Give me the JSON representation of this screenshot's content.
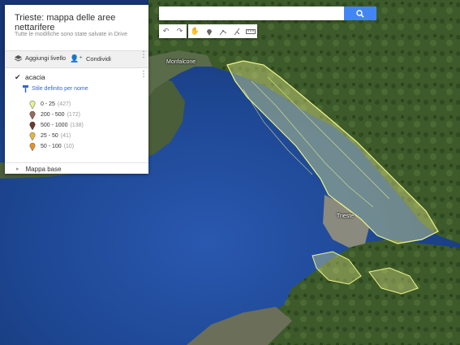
{
  "panel": {
    "title": "Trieste: mappa delle aree nettarifere",
    "subtitle": "Tutte le modifiche sono state salvate in Drive",
    "add_layer": "Aggiungi livello",
    "share": "Condividi"
  },
  "layer": {
    "name": "acacia",
    "style": "Stile definito per nome",
    "legend": [
      {
        "label": "0 - 25",
        "count": "(427)",
        "color": "#eaf08c"
      },
      {
        "label": "200 - 500",
        "count": "(172)",
        "color": "#9a6b5b"
      },
      {
        "label": "500 - 1000",
        "count": "(138)",
        "color": "#6e3a2e"
      },
      {
        "label": "25 - 50",
        "count": "(41)",
        "color": "#e8b53a"
      },
      {
        "label": "50 - 100",
        "count": "(10)",
        "color": "#e2921e"
      }
    ]
  },
  "basemap": {
    "label": "Mappa base"
  },
  "search": {
    "value": "",
    "placeholder": ""
  },
  "colors": {
    "accent": "#4285f4",
    "link": "#3367d6",
    "polygon_outline": "#f2f58a"
  },
  "toolbar_icons": [
    "undo-icon",
    "redo-icon",
    "hand-icon",
    "marker-icon",
    "line-icon",
    "route-icon",
    "ruler-icon"
  ],
  "map_labels": [
    "Monfalcone",
    "Trieste"
  ]
}
